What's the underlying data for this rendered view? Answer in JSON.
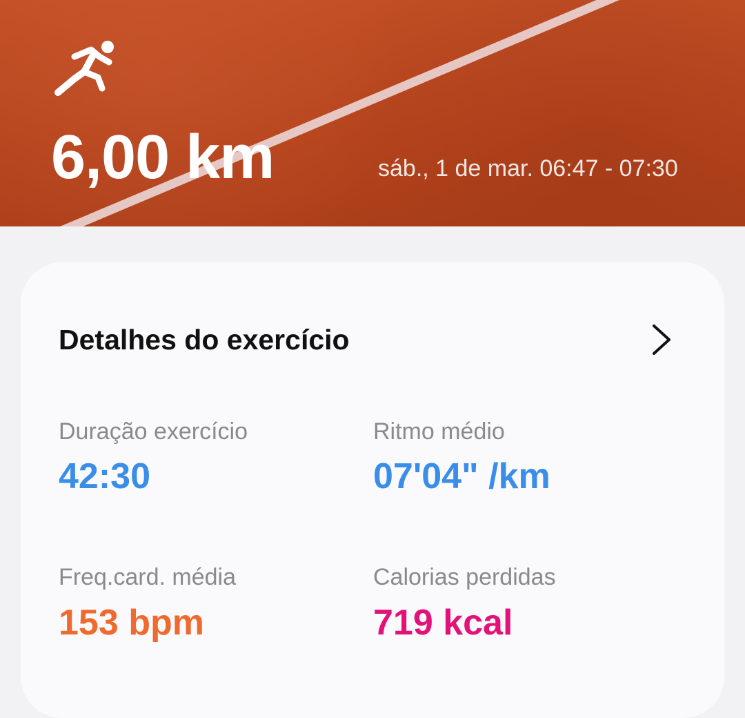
{
  "header": {
    "activity_icon": "running-person-icon",
    "distance": "6,00 km",
    "datetime": "sáb., 1 de mar. 06:47 - 07:30"
  },
  "details": {
    "title": "Detalhes do exercício",
    "chevron_icon": "chevron-right-icon",
    "stats": [
      {
        "label": "Duração exercício",
        "value": "42:30",
        "color": "#3b8ee8"
      },
      {
        "label": "Ritmo médio",
        "value": "07'04\" /km",
        "color": "#3b8ee8"
      },
      {
        "label": "Freq.card. média",
        "value": "153 bpm",
        "color": "#ef6a2e"
      },
      {
        "label": "Calorias perdidas",
        "value": "719 kcal",
        "color": "#e3127a"
      }
    ]
  },
  "colors": {
    "track": "#b9471f",
    "card_bg": "#fafafc",
    "page_bg": "#f2f2f4"
  }
}
